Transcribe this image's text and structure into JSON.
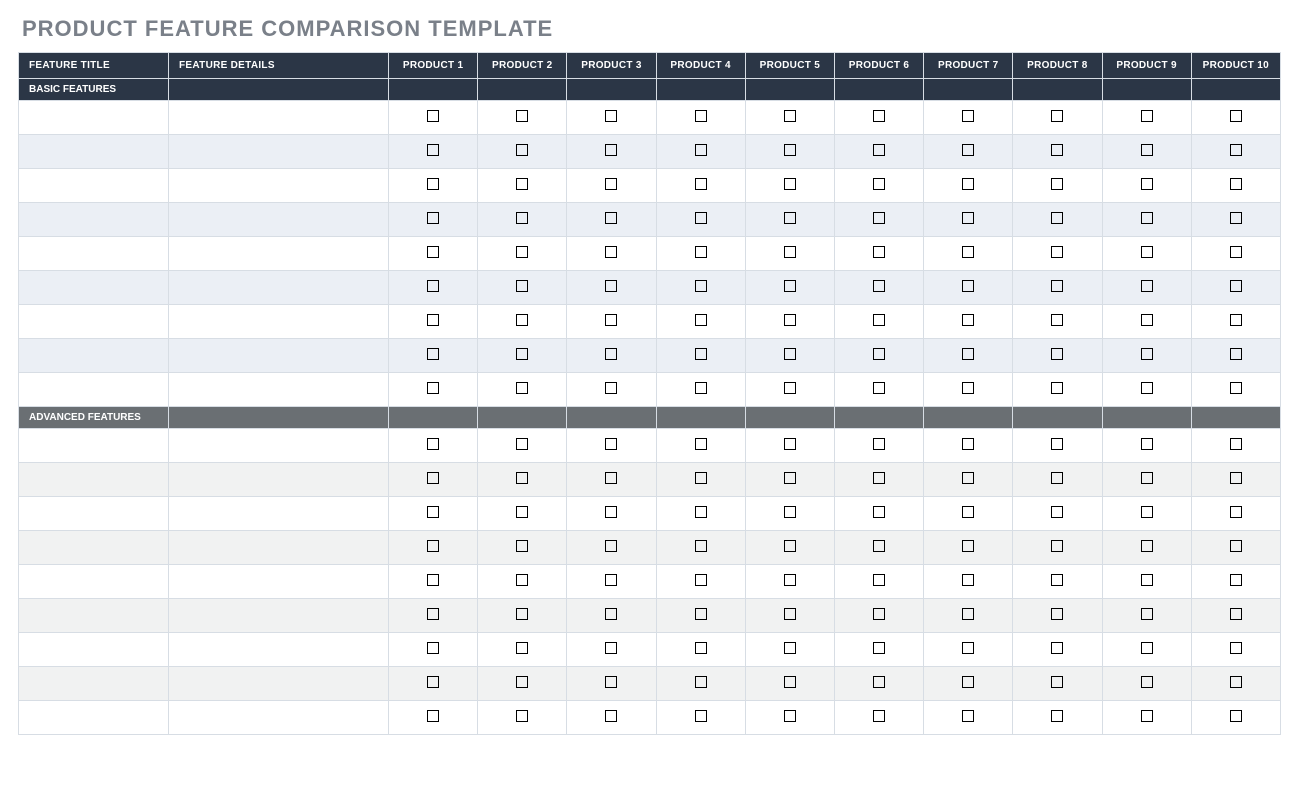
{
  "title": "PRODUCT FEATURE COMPARISON TEMPLATE",
  "columns": {
    "feature_title": "FEATURE TITLE",
    "feature_details": "FEATURE DETAILS",
    "products": [
      "PRODUCT 1",
      "PRODUCT 2",
      "PRODUCT 3",
      "PRODUCT 4",
      "PRODUCT 5",
      "PRODUCT 6",
      "PRODUCT 7",
      "PRODUCT 8",
      "PRODUCT 9",
      "PRODUCT 10"
    ]
  },
  "sections": [
    {
      "label": "BASIC FEATURES",
      "kind": "basic",
      "rows": [
        {
          "title": "",
          "details": "",
          "checks": [
            false,
            false,
            false,
            false,
            false,
            false,
            false,
            false,
            false,
            false
          ]
        },
        {
          "title": "",
          "details": "",
          "checks": [
            false,
            false,
            false,
            false,
            false,
            false,
            false,
            false,
            false,
            false
          ]
        },
        {
          "title": "",
          "details": "",
          "checks": [
            false,
            false,
            false,
            false,
            false,
            false,
            false,
            false,
            false,
            false
          ]
        },
        {
          "title": "",
          "details": "",
          "checks": [
            false,
            false,
            false,
            false,
            false,
            false,
            false,
            false,
            false,
            false
          ]
        },
        {
          "title": "",
          "details": "",
          "checks": [
            false,
            false,
            false,
            false,
            false,
            false,
            false,
            false,
            false,
            false
          ]
        },
        {
          "title": "",
          "details": "",
          "checks": [
            false,
            false,
            false,
            false,
            false,
            false,
            false,
            false,
            false,
            false
          ]
        },
        {
          "title": "",
          "details": "",
          "checks": [
            false,
            false,
            false,
            false,
            false,
            false,
            false,
            false,
            false,
            false
          ]
        },
        {
          "title": "",
          "details": "",
          "checks": [
            false,
            false,
            false,
            false,
            false,
            false,
            false,
            false,
            false,
            false
          ]
        },
        {
          "title": "",
          "details": "",
          "checks": [
            false,
            false,
            false,
            false,
            false,
            false,
            false,
            false,
            false,
            false
          ]
        }
      ]
    },
    {
      "label": "ADVANCED FEATURES",
      "kind": "advanced",
      "rows": [
        {
          "title": "",
          "details": "",
          "checks": [
            false,
            false,
            false,
            false,
            false,
            false,
            false,
            false,
            false,
            false
          ]
        },
        {
          "title": "",
          "details": "",
          "checks": [
            false,
            false,
            false,
            false,
            false,
            false,
            false,
            false,
            false,
            false
          ]
        },
        {
          "title": "",
          "details": "",
          "checks": [
            false,
            false,
            false,
            false,
            false,
            false,
            false,
            false,
            false,
            false
          ]
        },
        {
          "title": "",
          "details": "",
          "checks": [
            false,
            false,
            false,
            false,
            false,
            false,
            false,
            false,
            false,
            false
          ]
        },
        {
          "title": "",
          "details": "",
          "checks": [
            false,
            false,
            false,
            false,
            false,
            false,
            false,
            false,
            false,
            false
          ]
        },
        {
          "title": "",
          "details": "",
          "checks": [
            false,
            false,
            false,
            false,
            false,
            false,
            false,
            false,
            false,
            false
          ]
        },
        {
          "title": "",
          "details": "",
          "checks": [
            false,
            false,
            false,
            false,
            false,
            false,
            false,
            false,
            false,
            false
          ]
        },
        {
          "title": "",
          "details": "",
          "checks": [
            false,
            false,
            false,
            false,
            false,
            false,
            false,
            false,
            false,
            false
          ]
        },
        {
          "title": "",
          "details": "",
          "checks": [
            false,
            false,
            false,
            false,
            false,
            false,
            false,
            false,
            false,
            false
          ]
        }
      ]
    }
  ]
}
